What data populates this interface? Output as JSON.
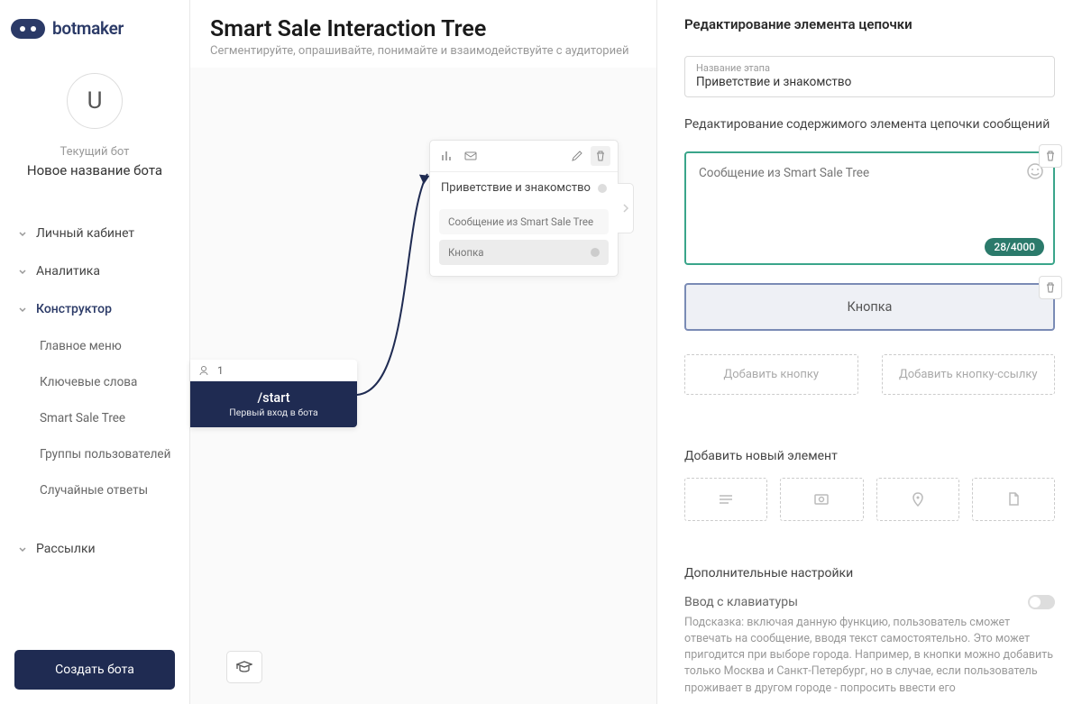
{
  "logo": {
    "text": "botmaker"
  },
  "user": {
    "avatar_initial": "U",
    "current_bot_label": "Текущий бот",
    "bot_name": "Новое название бота"
  },
  "nav": {
    "items": [
      {
        "label": "Личный кабинет",
        "expanded": false
      },
      {
        "label": "Аналитика",
        "expanded": false
      },
      {
        "label": "Конструктор",
        "expanded": true,
        "children": [
          {
            "label": "Главное меню"
          },
          {
            "label": "Ключевые слова"
          },
          {
            "label": "Smart Sale Tree"
          },
          {
            "label": "Группы пользователей"
          },
          {
            "label": "Случайные ответы"
          }
        ]
      },
      {
        "label": "Рассылки",
        "expanded": false
      }
    ]
  },
  "create_button": "Создать бота",
  "page": {
    "title": "Smart Sale Interaction Tree",
    "subtitle": "Сегментируйте, опрашивайте, понимайте и взаимодействуйте с аудиторией"
  },
  "start_node": {
    "count": "1",
    "title": "/start",
    "subtitle": "Первый вход в бота"
  },
  "chain_node": {
    "title": "Приветствие и знакомство",
    "message": "Сообщение из Smart Sale Tree",
    "button_label": "Кнопка"
  },
  "panel": {
    "title": "Редактирование элемента цепочки",
    "stage_label": "Название этапа",
    "stage_value": "Приветствие и знакомство",
    "content_label": "Редактирование содержимого элемента цепочки сообщений",
    "message_text": "Сообщение из Smart Sale Tree",
    "counter": "28/4000",
    "button_box": "Кнопка",
    "add_button": "Добавить кнопку",
    "add_link_button": "Добавить кнопку-ссылку",
    "add_element_heading": "Добавить новый элемент",
    "additional_settings": "Дополнительные настройки",
    "keyboard_input": "Ввод с клавиатуры",
    "hint": "Подсказка: включая данную функцию, пользователь сможет отвечать на сообщение, вводя текст самостоятельно. Это может пригодится при выборе города. Например, в кнопки можно добавить только Москва и Санкт-Петербург, но в случае, если пользователь проживает в другом городе - попросить ввести его"
  }
}
